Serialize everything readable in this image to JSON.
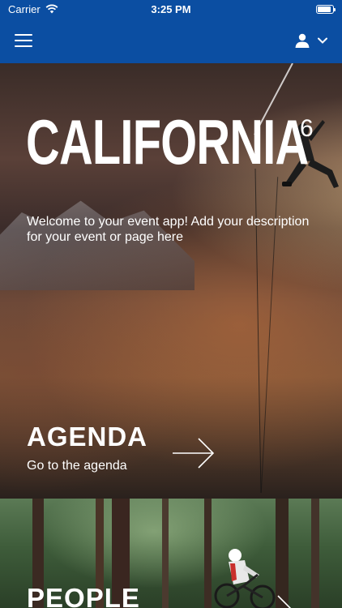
{
  "status_bar": {
    "carrier": "Carrier",
    "time": "3:25 PM",
    "battery_level": 0.9
  },
  "nav": {
    "menu_icon": "hamburger-menu-icon",
    "profile_icon": "user-icon",
    "dropdown_icon": "chevron-down-icon"
  },
  "hero": {
    "title": "CALIFORNIA",
    "superscript": "6",
    "description": "Welcome to your event app! Add your description for your event or page here"
  },
  "agenda": {
    "title": "AGENDA",
    "subtitle": "Go to the agenda",
    "arrow_icon": "arrow-right-icon"
  },
  "people": {
    "title": "PEOPLE",
    "arrow_icon": "arrow-right-icon"
  },
  "colors": {
    "nav_background": "#0b4ea2",
    "text": "#ffffff"
  }
}
